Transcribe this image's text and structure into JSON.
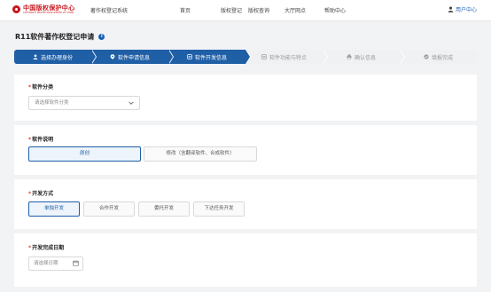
{
  "header": {
    "logo_cn": "中国版权保护中心",
    "logo_en": "COPYRIGHT PROTECTION CENTER OF CHINA",
    "system_name": "著作权登记系统",
    "nav": [
      "首页",
      "版权登记",
      "版权查询",
      "大厅网点",
      "帮助中心"
    ],
    "user_label": "用户中心"
  },
  "page": {
    "title": "R11软件著作权登记申请",
    "info_icon": "i"
  },
  "steps": [
    {
      "label": "选择办理身份",
      "icon": "person-icon",
      "state": "done"
    },
    {
      "label": "软件申请信息",
      "icon": "location-icon",
      "state": "done"
    },
    {
      "label": "软件开发信息",
      "icon": "document-icon",
      "state": "done"
    },
    {
      "label": "软件功能与特点",
      "icon": "document-icon",
      "state": "todo"
    },
    {
      "label": "确认信息",
      "icon": "printer-icon",
      "state": "todo"
    },
    {
      "label": "填报完成",
      "icon": "check-circle-icon",
      "state": "todo"
    }
  ],
  "sections": {
    "category": {
      "required_mark": "*",
      "label": "软件分类",
      "placeholder": "请选择软件分类"
    },
    "description": {
      "required_mark": "*",
      "label": "软件说明",
      "options": [
        "原创",
        "修改（含翻译软件、合成软件）"
      ],
      "selected": 0
    },
    "dev_method": {
      "required_mark": "*",
      "label": "开发方式",
      "options": [
        "单独开发",
        "合作开发",
        "委托开发",
        "下达任务开发"
      ],
      "selected": 0
    },
    "completion_date": {
      "required_mark": "*",
      "label": "开发完成日期",
      "placeholder": "请选择日期"
    }
  },
  "colors": {
    "primary": "#1f5fa6",
    "brand_red": "#c8171e",
    "required": "#e03a3a"
  }
}
